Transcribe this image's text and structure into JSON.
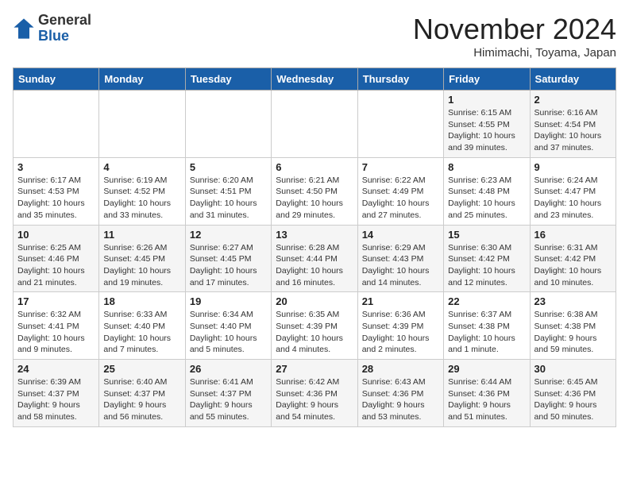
{
  "header": {
    "logo_general": "General",
    "logo_blue": "Blue",
    "title": "November 2024",
    "subtitle": "Himimachi, Toyama, Japan"
  },
  "weekdays": [
    "Sunday",
    "Monday",
    "Tuesday",
    "Wednesday",
    "Thursday",
    "Friday",
    "Saturday"
  ],
  "weeks": [
    [
      {
        "day": "",
        "info": ""
      },
      {
        "day": "",
        "info": ""
      },
      {
        "day": "",
        "info": ""
      },
      {
        "day": "",
        "info": ""
      },
      {
        "day": "",
        "info": ""
      },
      {
        "day": "1",
        "info": "Sunrise: 6:15 AM\nSunset: 4:55 PM\nDaylight: 10 hours\nand 39 minutes."
      },
      {
        "day": "2",
        "info": "Sunrise: 6:16 AM\nSunset: 4:54 PM\nDaylight: 10 hours\nand 37 minutes."
      }
    ],
    [
      {
        "day": "3",
        "info": "Sunrise: 6:17 AM\nSunset: 4:53 PM\nDaylight: 10 hours\nand 35 minutes."
      },
      {
        "day": "4",
        "info": "Sunrise: 6:19 AM\nSunset: 4:52 PM\nDaylight: 10 hours\nand 33 minutes."
      },
      {
        "day": "5",
        "info": "Sunrise: 6:20 AM\nSunset: 4:51 PM\nDaylight: 10 hours\nand 31 minutes."
      },
      {
        "day": "6",
        "info": "Sunrise: 6:21 AM\nSunset: 4:50 PM\nDaylight: 10 hours\nand 29 minutes."
      },
      {
        "day": "7",
        "info": "Sunrise: 6:22 AM\nSunset: 4:49 PM\nDaylight: 10 hours\nand 27 minutes."
      },
      {
        "day": "8",
        "info": "Sunrise: 6:23 AM\nSunset: 4:48 PM\nDaylight: 10 hours\nand 25 minutes."
      },
      {
        "day": "9",
        "info": "Sunrise: 6:24 AM\nSunset: 4:47 PM\nDaylight: 10 hours\nand 23 minutes."
      }
    ],
    [
      {
        "day": "10",
        "info": "Sunrise: 6:25 AM\nSunset: 4:46 PM\nDaylight: 10 hours\nand 21 minutes."
      },
      {
        "day": "11",
        "info": "Sunrise: 6:26 AM\nSunset: 4:45 PM\nDaylight: 10 hours\nand 19 minutes."
      },
      {
        "day": "12",
        "info": "Sunrise: 6:27 AM\nSunset: 4:45 PM\nDaylight: 10 hours\nand 17 minutes."
      },
      {
        "day": "13",
        "info": "Sunrise: 6:28 AM\nSunset: 4:44 PM\nDaylight: 10 hours\nand 16 minutes."
      },
      {
        "day": "14",
        "info": "Sunrise: 6:29 AM\nSunset: 4:43 PM\nDaylight: 10 hours\nand 14 minutes."
      },
      {
        "day": "15",
        "info": "Sunrise: 6:30 AM\nSunset: 4:42 PM\nDaylight: 10 hours\nand 12 minutes."
      },
      {
        "day": "16",
        "info": "Sunrise: 6:31 AM\nSunset: 4:42 PM\nDaylight: 10 hours\nand 10 minutes."
      }
    ],
    [
      {
        "day": "17",
        "info": "Sunrise: 6:32 AM\nSunset: 4:41 PM\nDaylight: 10 hours\nand 9 minutes."
      },
      {
        "day": "18",
        "info": "Sunrise: 6:33 AM\nSunset: 4:40 PM\nDaylight: 10 hours\nand 7 minutes."
      },
      {
        "day": "19",
        "info": "Sunrise: 6:34 AM\nSunset: 4:40 PM\nDaylight: 10 hours\nand 5 minutes."
      },
      {
        "day": "20",
        "info": "Sunrise: 6:35 AM\nSunset: 4:39 PM\nDaylight: 10 hours\nand 4 minutes."
      },
      {
        "day": "21",
        "info": "Sunrise: 6:36 AM\nSunset: 4:39 PM\nDaylight: 10 hours\nand 2 minutes."
      },
      {
        "day": "22",
        "info": "Sunrise: 6:37 AM\nSunset: 4:38 PM\nDaylight: 10 hours\nand 1 minute."
      },
      {
        "day": "23",
        "info": "Sunrise: 6:38 AM\nSunset: 4:38 PM\nDaylight: 9 hours\nand 59 minutes."
      }
    ],
    [
      {
        "day": "24",
        "info": "Sunrise: 6:39 AM\nSunset: 4:37 PM\nDaylight: 9 hours\nand 58 minutes."
      },
      {
        "day": "25",
        "info": "Sunrise: 6:40 AM\nSunset: 4:37 PM\nDaylight: 9 hours\nand 56 minutes."
      },
      {
        "day": "26",
        "info": "Sunrise: 6:41 AM\nSunset: 4:37 PM\nDaylight: 9 hours\nand 55 minutes."
      },
      {
        "day": "27",
        "info": "Sunrise: 6:42 AM\nSunset: 4:36 PM\nDaylight: 9 hours\nand 54 minutes."
      },
      {
        "day": "28",
        "info": "Sunrise: 6:43 AM\nSunset: 4:36 PM\nDaylight: 9 hours\nand 53 minutes."
      },
      {
        "day": "29",
        "info": "Sunrise: 6:44 AM\nSunset: 4:36 PM\nDaylight: 9 hours\nand 51 minutes."
      },
      {
        "day": "30",
        "info": "Sunrise: 6:45 AM\nSunset: 4:36 PM\nDaylight: 9 hours\nand 50 minutes."
      }
    ]
  ]
}
